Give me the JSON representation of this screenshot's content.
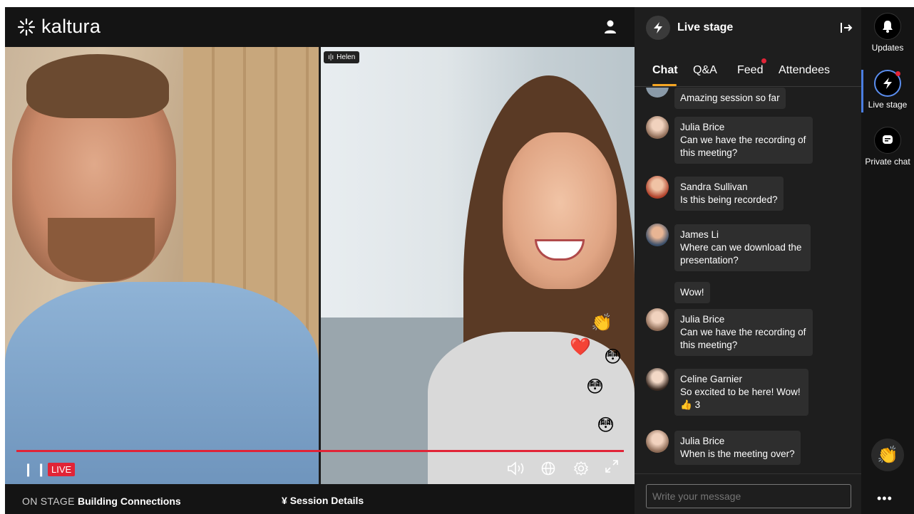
{
  "brand": {
    "name": "kaltura"
  },
  "video": {
    "speaker_tag": "Helen",
    "live_label": "LIVE",
    "reactions": [
      "👏",
      "❤️",
      "😳",
      "😳",
      "😳"
    ]
  },
  "bottom": {
    "on_stage_label": "ON STAGE",
    "session_title": "Building Connections",
    "session_details_label": "Session Details"
  },
  "panel": {
    "title": "Live stage",
    "tabs": [
      {
        "label": "Chat",
        "active": true
      },
      {
        "label": "Q&A",
        "active": false
      },
      {
        "label": "Feed",
        "active": false,
        "badge": true
      },
      {
        "label": "Attendees",
        "active": false
      }
    ],
    "messages": [
      {
        "author": "",
        "text": "Amazing session so far"
      },
      {
        "author": "Julia Brice",
        "text": "Can we have the recording of this meeting?"
      },
      {
        "author": "Sandra Sullivan",
        "text": "Is this being recorded?"
      },
      {
        "author": "James Li",
        "text": "Where can we download the presentation?"
      },
      {
        "author": "",
        "text": "Wow!"
      },
      {
        "author": "Julia Brice",
        "text": "Can we have the recording of this meeting?"
      },
      {
        "author": "Celine Garnier",
        "text": "So excited to be here! Wow!",
        "reaction_count": "3"
      },
      {
        "author": "Julia Brice",
        "text": "When is the meeting over?"
      }
    ],
    "composer_placeholder": "Write your message"
  },
  "rail": {
    "items": [
      {
        "label": "Updates"
      },
      {
        "label": "Live stage"
      },
      {
        "label": "Private chat"
      }
    ],
    "more_label": "•••"
  },
  "colors": {
    "accent": "#e12437",
    "tab_underline": "#f5a623",
    "active_blue": "#4a7de0"
  }
}
